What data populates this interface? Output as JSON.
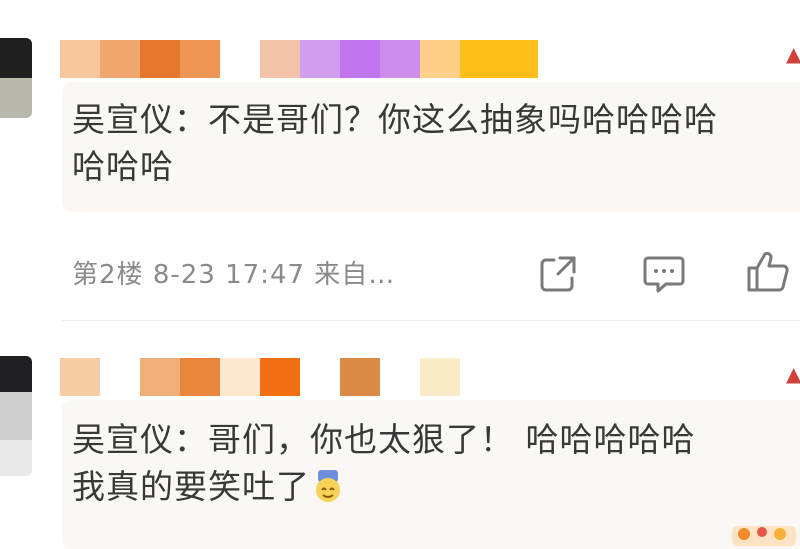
{
  "comments": [
    {
      "quote_line1": "吴宣仪：不是哥们？你这么抽象吗哈哈哈哈",
      "quote_line2": "哈哈哈",
      "floor": "第2楼",
      "date": "8-23",
      "time": "17:47",
      "source": "来自…"
    },
    {
      "quote_line1": "吴宣仪：哥们，你也太狠了！ 哈哈哈哈哈",
      "quote_line2": "我真的要笑吐了",
      "emoji_icon": "laughing-vomit-emoji-icon"
    }
  ],
  "actions": {
    "share_icon": "share-icon",
    "comment_icon": "comment-icon",
    "like_icon": "thumbs-up-icon"
  },
  "colors": {
    "quote_bg": "#fbf7f5",
    "meta_text": "#8a8a8a",
    "accent": "#f08a2c"
  }
}
